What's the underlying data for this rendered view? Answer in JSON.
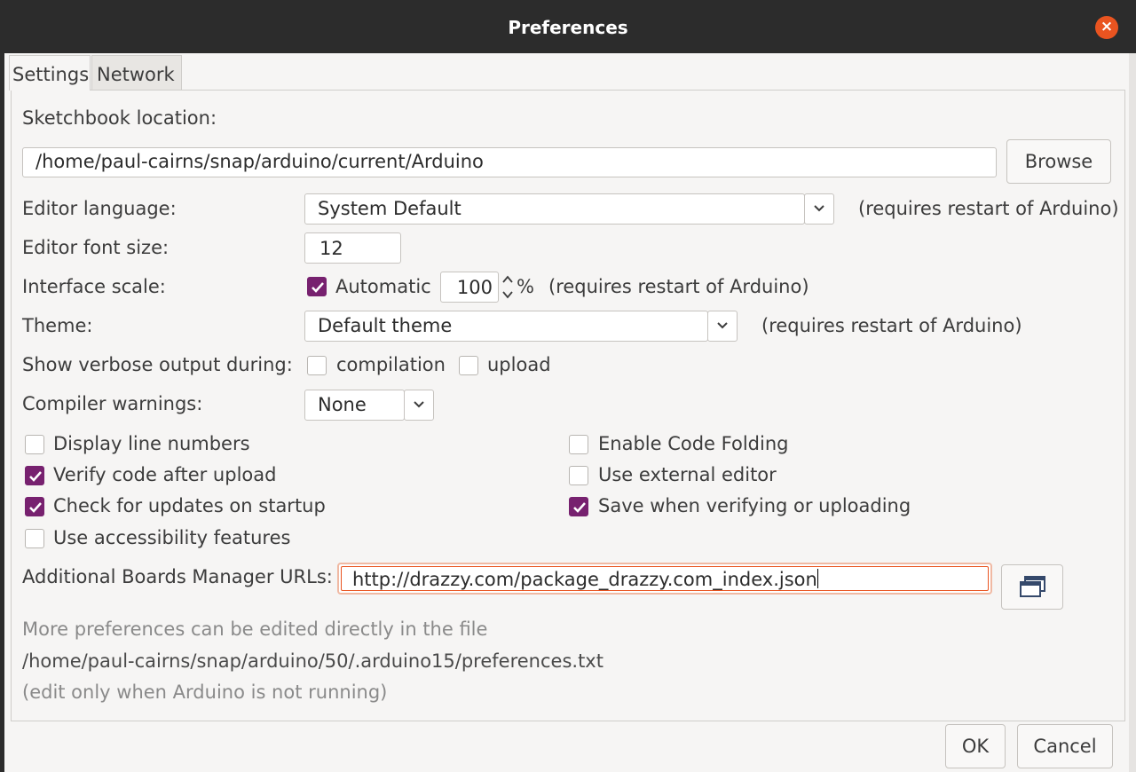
{
  "window": {
    "title": "Preferences",
    "close_glyph": "×"
  },
  "tabs": [
    {
      "label": "Settings"
    },
    {
      "label": "Network"
    }
  ],
  "sketchbook": {
    "label": "Sketchbook location:",
    "path": "/home/paul-cairns/snap/arduino/current/Arduino",
    "browse_label": "Browse"
  },
  "editor_language": {
    "label": "Editor language:",
    "value": "System Default",
    "note": "(requires restart of Arduino)"
  },
  "editor_font_size": {
    "label": "Editor font size:",
    "value": "12"
  },
  "interface_scale": {
    "label": "Interface scale:",
    "automatic_label": "Automatic",
    "automatic_checked": true,
    "value": "100",
    "unit": "%",
    "note": "(requires restart of Arduino)"
  },
  "theme": {
    "label": "Theme:",
    "value": "Default theme",
    "note": "(requires restart of Arduino)"
  },
  "verbose": {
    "label": "Show verbose output during:",
    "compilation_label": "compilation",
    "compilation_checked": false,
    "upload_label": "upload",
    "upload_checked": false
  },
  "compiler_warnings": {
    "label": "Compiler warnings:",
    "value": "None"
  },
  "options_left": [
    {
      "label": "Display line numbers",
      "checked": false
    },
    {
      "label": "Verify code after upload",
      "checked": true
    },
    {
      "label": "Check for updates on startup",
      "checked": true
    },
    {
      "label": "Use accessibility features",
      "checked": false
    }
  ],
  "options_right": [
    {
      "label": "Enable Code Folding",
      "checked": false
    },
    {
      "label": "Use external editor",
      "checked": false
    },
    {
      "label": "Save when verifying or uploading",
      "checked": true
    }
  ],
  "boards_manager": {
    "label": "Additional Boards Manager URLs:",
    "value": "http://drazzy.com/package_drazzy.com_index.json"
  },
  "footer_info": {
    "line1": "More preferences can be edited directly in the file",
    "path": "/home/paul-cairns/snap/arduino/50/.arduino15/preferences.txt",
    "line3": "(edit only when Arduino is not running)"
  },
  "buttons": {
    "ok": "OK",
    "cancel": "Cancel"
  },
  "colors": {
    "accent": "#77216f",
    "focus": "#e95420",
    "titlebar": "#2c2c2c"
  }
}
